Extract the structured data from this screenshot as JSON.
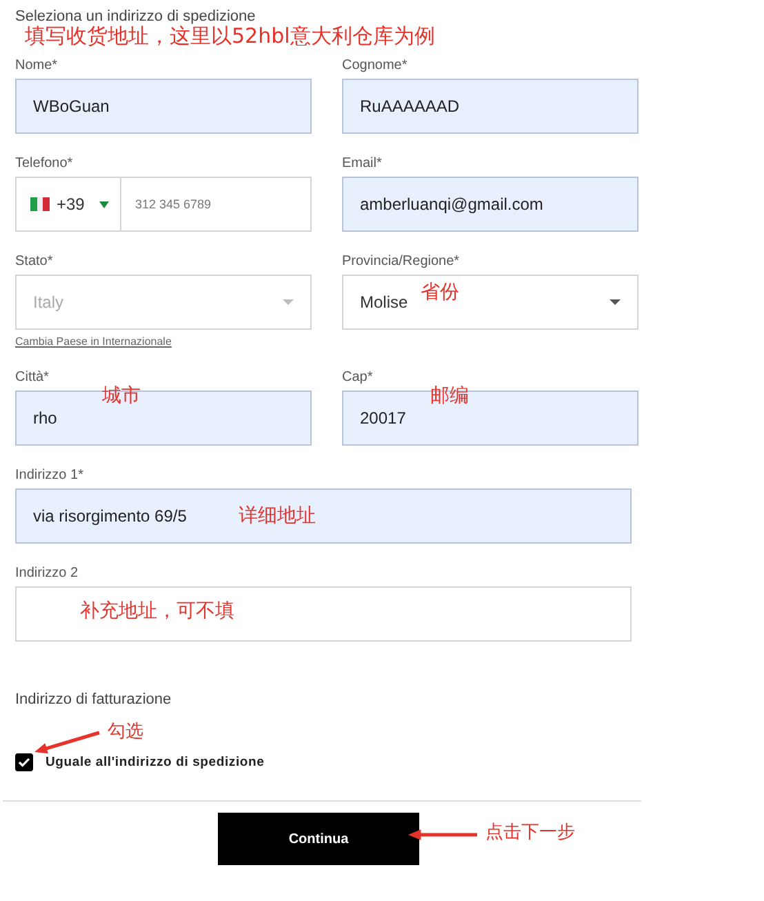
{
  "form": {
    "title": "Seleziona un indirizzo di spedizione",
    "fields": [
      {
        "kind": "text",
        "label": "Nome*",
        "value": "WBoGuan",
        "autofilled": true
      },
      {
        "kind": "text",
        "label": "Cognome*",
        "value": "RuAAAAAAD",
        "autofilled": true
      },
      {
        "kind": "phone",
        "label": "Telefono*",
        "prefix": "+39",
        "placeholder": "312 345 6789",
        "autofilled": false
      },
      {
        "kind": "text",
        "label": "Email*",
        "value": "amberluanqi@gmail.com",
        "autofilled": true
      },
      {
        "kind": "select",
        "label": "Stato*",
        "value": "Italy",
        "disabled": true,
        "link": "Cambia Paese in Internazionale"
      },
      {
        "kind": "select",
        "label": "Provincia/Regione*",
        "value": "Molise",
        "disabled": false
      },
      {
        "kind": "text",
        "label": "Città*",
        "value": "rho",
        "autofilled": true
      },
      {
        "kind": "text",
        "label": "Cap*",
        "value": "20017",
        "autofilled": true
      },
      {
        "kind": "wide",
        "label": "Indirizzo 1*",
        "value": "via risorgimento 69/5",
        "autofilled": true
      },
      {
        "kind": "wide",
        "label": "Indirizzo 2",
        "autofilled": false
      }
    ],
    "billing": {
      "title": "Indirizzo di fatturazione",
      "checkbox": {
        "label": "Uguale all'indirizzo di spedizione",
        "checked": true
      }
    },
    "button": "Continua"
  },
  "annotations": [
    {
      "text": "填写收货地址，这里以52hbl意大利仓库为例",
      "arrow": false
    },
    {
      "text": "省份",
      "arrow": false
    },
    {
      "text": "城市",
      "arrow": false
    },
    {
      "text": "邮编",
      "arrow": false
    },
    {
      "text": "详细地址",
      "arrow": false
    },
    {
      "text": "补充地址，可不填",
      "arrow": false
    },
    {
      "text": "勾选",
      "arrow": true
    },
    {
      "text": "点击下一步",
      "arrow": true
    }
  ]
}
